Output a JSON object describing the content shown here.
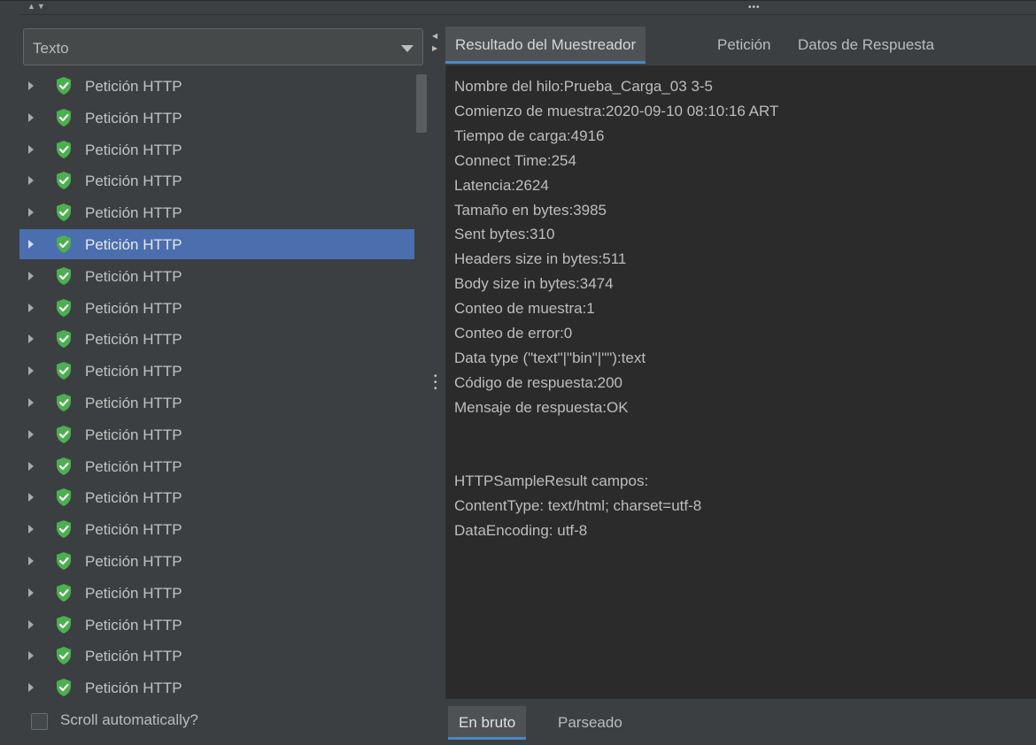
{
  "filter_combo": {
    "selected": "Texto"
  },
  "tree": {
    "items": [
      {
        "label": "Petición HTTP",
        "status": "success"
      },
      {
        "label": "Petición HTTP",
        "status": "success"
      },
      {
        "label": "Petición HTTP",
        "status": "success"
      },
      {
        "label": "Petición HTTP",
        "status": "success"
      },
      {
        "label": "Petición HTTP",
        "status": "success"
      },
      {
        "label": "Petición HTTP",
        "status": "success",
        "selected": true
      },
      {
        "label": "Petición HTTP",
        "status": "success"
      },
      {
        "label": "Petición HTTP",
        "status": "success"
      },
      {
        "label": "Petición HTTP",
        "status": "success"
      },
      {
        "label": "Petición HTTP",
        "status": "success"
      },
      {
        "label": "Petición HTTP",
        "status": "success"
      },
      {
        "label": "Petición HTTP",
        "status": "success"
      },
      {
        "label": "Petición HTTP",
        "status": "success"
      },
      {
        "label": "Petición HTTP",
        "status": "success"
      },
      {
        "label": "Petición HTTP",
        "status": "success"
      },
      {
        "label": "Petición HTTP",
        "status": "success"
      },
      {
        "label": "Petición HTTP",
        "status": "success"
      },
      {
        "label": "Petición HTTP",
        "status": "success"
      },
      {
        "label": "Petición HTTP",
        "status": "success"
      },
      {
        "label": "Petición HTTP",
        "status": "success"
      }
    ]
  },
  "scroll_checkbox": {
    "label": "Scroll automatically?",
    "checked": false
  },
  "tabs": [
    {
      "label": "Resultado del Muestreador",
      "active": true
    },
    {
      "label": "Petición",
      "active": false
    },
    {
      "label": "Datos de Respuesta",
      "active": false
    }
  ],
  "sampler_result": {
    "lines": [
      "Nombre del hilo:Prueba_Carga_03 3-5",
      "Comienzo de muestra:2020-09-10 08:10:16 ART",
      "Tiempo de carga:4916",
      "Connect Time:254",
      "Latencia:2624",
      "Tamaño en bytes:3985",
      "Sent bytes:310",
      "Headers size in bytes:511",
      "Body size in bytes:3474",
      "Conteo de muestra:1",
      "Conteo de error:0",
      "Data type (\"text\"|\"bin\"|\"\"):text",
      "Código de respuesta:200",
      "Mensaje de respuesta:OK",
      "",
      "",
      "HTTPSampleResult campos:",
      "ContentType: text/html; charset=utf-8",
      "DataEncoding: utf-8"
    ]
  },
  "bottom_tabs": [
    {
      "label": "En bruto",
      "active": true
    },
    {
      "label": "Parseado",
      "active": false
    }
  ],
  "colors": {
    "background": "#3c3f41",
    "content_background": "#2b2b2b",
    "selection": "#4b6eaf",
    "success_icon": "#4caf50",
    "tab_underline": "#4a88c7"
  },
  "icons": {
    "tree_item": "shield-check-icon",
    "expander": "triangle-right-icon",
    "combo": "chevron-down-icon"
  }
}
